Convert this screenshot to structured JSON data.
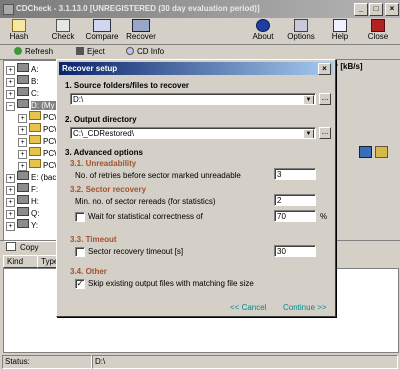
{
  "window": {
    "title": "CDCheck - 3.1.13.0 [UNREGISTERED (30 day evaluation period)]",
    "minimize": "_",
    "maximize": "□",
    "close": "×"
  },
  "toolbar": {
    "items": [
      {
        "label": "Hash",
        "icon": "hash-icon"
      },
      {
        "label": "Check",
        "icon": "check-icon"
      },
      {
        "label": "Compare",
        "icon": "compare-icon"
      },
      {
        "label": "Recover",
        "icon": "recover-icon"
      },
      {
        "label": "About",
        "icon": "info-icon"
      },
      {
        "label": "Options",
        "icon": "options-icon"
      },
      {
        "label": "Help",
        "icon": "help-icon"
      },
      {
        "label": "Close",
        "icon": "exit-icon"
      }
    ]
  },
  "toolbar2": {
    "refresh": "Refresh",
    "eject": "Eject",
    "cdinfo": "CD Info"
  },
  "tree": {
    "items": [
      {
        "label": "A:",
        "kind": "drive"
      },
      {
        "label": "B:",
        "kind": "drive"
      },
      {
        "label": "C:",
        "kind": "drive"
      },
      {
        "label": "D: (My D",
        "kind": "drive"
      },
      {
        "label": "PCW",
        "kind": "folder"
      },
      {
        "label": "PCW",
        "kind": "folder"
      },
      {
        "label": "PCW",
        "kind": "folder"
      },
      {
        "label": "PCW",
        "kind": "folder"
      },
      {
        "label": "PCW",
        "kind": "folder"
      },
      {
        "label": "E: (back",
        "kind": "drive"
      },
      {
        "label": "F:",
        "kind": "drive"
      },
      {
        "label": "H:",
        "kind": "drive"
      },
      {
        "label": "Q:",
        "kind": "drive"
      },
      {
        "label": "Y:",
        "kind": "drive"
      }
    ]
  },
  "right_panel": {
    "speed_header": "r [kB/s]"
  },
  "copy_bar": {
    "copy": "Copy"
  },
  "list": {
    "columns": [
      "Kind",
      "Type"
    ]
  },
  "status": {
    "label": "Status:",
    "path": "D:\\"
  },
  "dialog": {
    "title": "Recover setup",
    "close": "×",
    "section1": "1. Source folders/files to recover",
    "source_value": "D:\\",
    "section2": "2. Output directory",
    "output_value": "C:\\_CDRestored\\",
    "browse": "...",
    "section3": "3. Advanced options",
    "s31": "3.1. Unreadability",
    "retries_label": "No. of retries before sector marked unreadable",
    "retries_value": "3",
    "s32": "3.2. Sector recovery",
    "rereads_label": "Min. no. of sector rereads (for statistics)",
    "rereads_value": "2",
    "wait_label": "Wait for statistical correctness of",
    "wait_value": "70",
    "wait_unit": "%",
    "wait_checked": false,
    "s33": "3.3. Timeout",
    "timeout_label": "Sector recovery timeout [s]",
    "timeout_value": "30",
    "timeout_checked": false,
    "s34": "3.4. Other",
    "skip_label": "Skip existing output files with matching file size",
    "skip_checked": true,
    "cancel": "<< Cancel",
    "continue": "Continue >>"
  },
  "colors": {
    "dialog_title_start": "#0a246a",
    "dialog_title_end": "#a6caf0",
    "subsection": "#a0522d",
    "link_button": "#008b8b"
  }
}
